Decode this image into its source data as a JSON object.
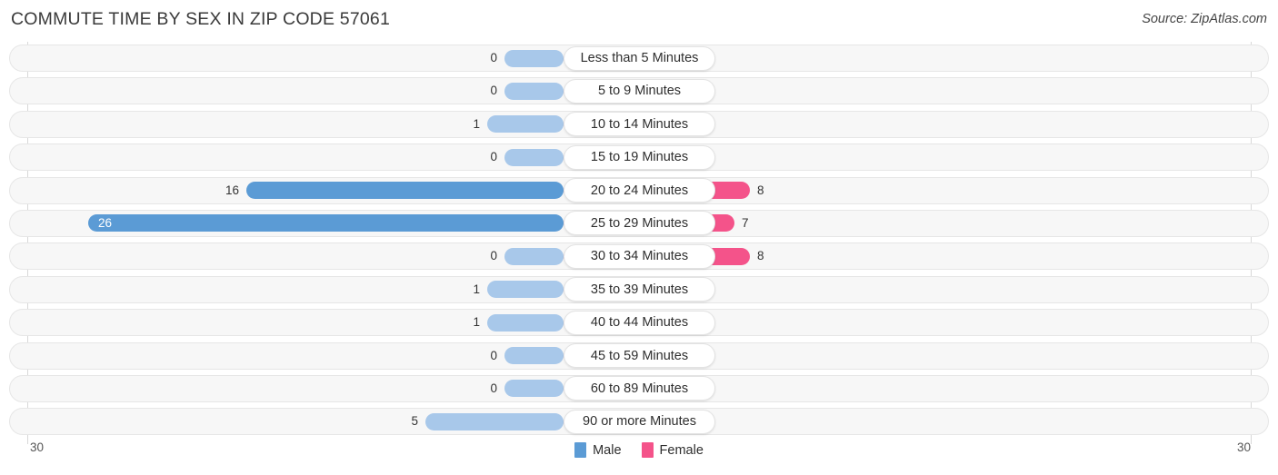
{
  "header": {
    "title": "COMMUTE TIME BY SEX IN ZIP CODE 57061",
    "source": "Source: ZipAtlas.com"
  },
  "legend": {
    "male_label": "Male",
    "female_label": "Female",
    "male_color": "#5b9bd5",
    "female_color": "#f4538a"
  },
  "axis": {
    "left_max": "30",
    "right_max": "30"
  },
  "colors": {
    "male_light": "#a8c8ea",
    "male_strong": "#5b9bd5",
    "female_light": "#f8a8c5",
    "female_strong": "#f4538a",
    "track_bg": "#f7f7f7",
    "track_border": "#e6e6e6",
    "gridline": "#d8d8d8"
  },
  "chart_data": {
    "type": "bar",
    "title": "COMMUTE TIME BY SEX IN ZIP CODE 57061",
    "subtitle": "Source: ZipAtlas.com",
    "orientation": "horizontal-diverging",
    "xlabel": "",
    "ylabel": "",
    "xlim": [
      30,
      30
    ],
    "grid": true,
    "legend_position": "bottom-center",
    "categories": [
      "Less than 5 Minutes",
      "5 to 9 Minutes",
      "10 to 14 Minutes",
      "15 to 19 Minutes",
      "20 to 24 Minutes",
      "25 to 29 Minutes",
      "30 to 34 Minutes",
      "35 to 39 Minutes",
      "40 to 44 Minutes",
      "45 to 59 Minutes",
      "60 to 89 Minutes",
      "90 or more Minutes"
    ],
    "series": [
      {
        "name": "Male",
        "values": [
          0,
          0,
          1,
          0,
          16,
          26,
          0,
          1,
          1,
          0,
          0,
          5
        ]
      },
      {
        "name": "Female",
        "values": [
          0,
          0,
          0,
          0,
          8,
          7,
          8,
          0,
          0,
          0,
          0,
          0
        ]
      }
    ]
  },
  "rows": [
    {
      "label": "Less than 5 Minutes",
      "male": "0",
      "female": "0",
      "male_w": 65,
      "female_w": 65,
      "male_strong": false,
      "female_strong": false,
      "male_inside": false
    },
    {
      "label": "5 to 9 Minutes",
      "male": "0",
      "female": "0",
      "male_w": 65,
      "female_w": 65,
      "male_strong": false,
      "female_strong": false,
      "male_inside": false
    },
    {
      "label": "10 to 14 Minutes",
      "male": "1",
      "female": "0",
      "male_w": 84,
      "female_w": 65,
      "male_strong": false,
      "female_strong": false,
      "male_inside": false
    },
    {
      "label": "15 to 19 Minutes",
      "male": "0",
      "female": "0",
      "male_w": 65,
      "female_w": 65,
      "male_strong": false,
      "female_strong": false,
      "male_inside": false
    },
    {
      "label": "20 to 24 Minutes",
      "male": "16",
      "female": "8",
      "male_w": 349,
      "female_w": 205,
      "male_strong": true,
      "female_strong": true,
      "male_inside": false
    },
    {
      "label": "25 to 29 Minutes",
      "male": "26",
      "female": "7",
      "male_w": 523,
      "female_w": 188,
      "male_strong": true,
      "female_strong": true,
      "male_inside": true
    },
    {
      "label": "30 to 34 Minutes",
      "male": "0",
      "female": "8",
      "male_w": 65,
      "female_w": 205,
      "male_strong": false,
      "female_strong": true,
      "male_inside": false
    },
    {
      "label": "35 to 39 Minutes",
      "male": "1",
      "female": "0",
      "male_w": 84,
      "female_w": 65,
      "male_strong": false,
      "female_strong": false,
      "male_inside": false
    },
    {
      "label": "40 to 44 Minutes",
      "male": "1",
      "female": "0",
      "male_w": 84,
      "female_w": 65,
      "male_strong": false,
      "female_strong": false,
      "male_inside": false
    },
    {
      "label": "45 to 59 Minutes",
      "male": "0",
      "female": "0",
      "male_w": 65,
      "female_w": 65,
      "male_strong": false,
      "female_strong": false,
      "male_inside": false
    },
    {
      "label": "60 to 89 Minutes",
      "male": "0",
      "female": "0",
      "male_w": 65,
      "female_w": 65,
      "male_strong": false,
      "female_strong": false,
      "male_inside": false
    },
    {
      "label": "90 or more Minutes",
      "male": "5",
      "female": "0",
      "male_w": 152,
      "female_w": 65,
      "male_strong": false,
      "female_strong": false,
      "male_inside": false
    }
  ]
}
